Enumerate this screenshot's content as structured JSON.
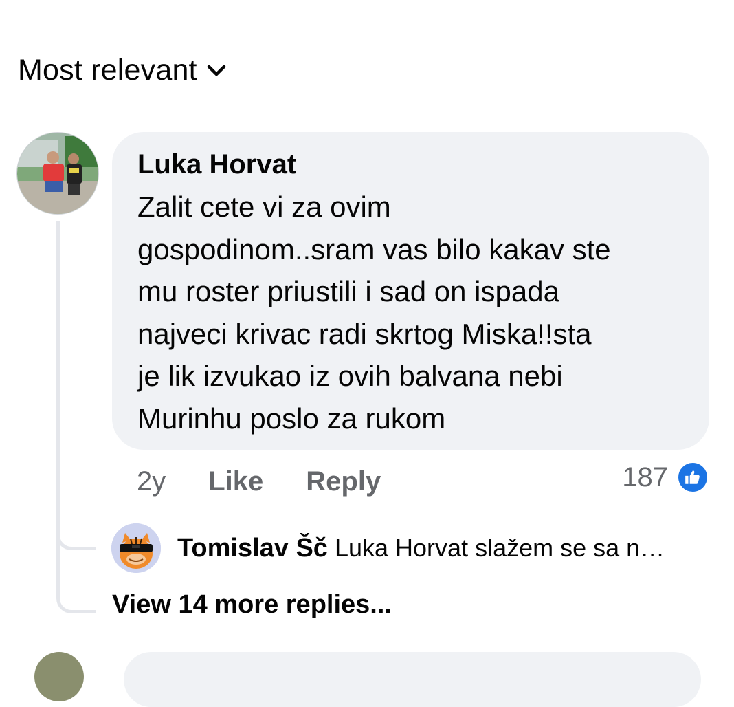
{
  "sort": {
    "label": "Most relevant",
    "icon": "chevron-down-icon"
  },
  "comment": {
    "author": "Luka Horvat",
    "text_lines": [
      "Zalit cete vi za ovim",
      "gospodinom..sram vas bilo kakav ste",
      "mu roster priustili i sad on ispada",
      "najveci krivac radi skrtog Miska!!sta",
      "je lik izvukao iz ovih balvana nebi",
      "Murinhu poslo za rukom"
    ],
    "time": "2y",
    "like_label": "Like",
    "reply_label": "Reply",
    "reaction_count": "187",
    "reaction_icon": "like-reaction-icon",
    "reaction_color": "#1b74e4"
  },
  "reply": {
    "author": "Tomislav Šč",
    "preview": "Luka Horvat slažem se sa n…"
  },
  "view_more": {
    "label": "View 14 more replies..."
  },
  "colors": {
    "bubble": "#f0f2f5",
    "secondary_text": "#65676b",
    "thread_line": "#e4e6eb"
  }
}
